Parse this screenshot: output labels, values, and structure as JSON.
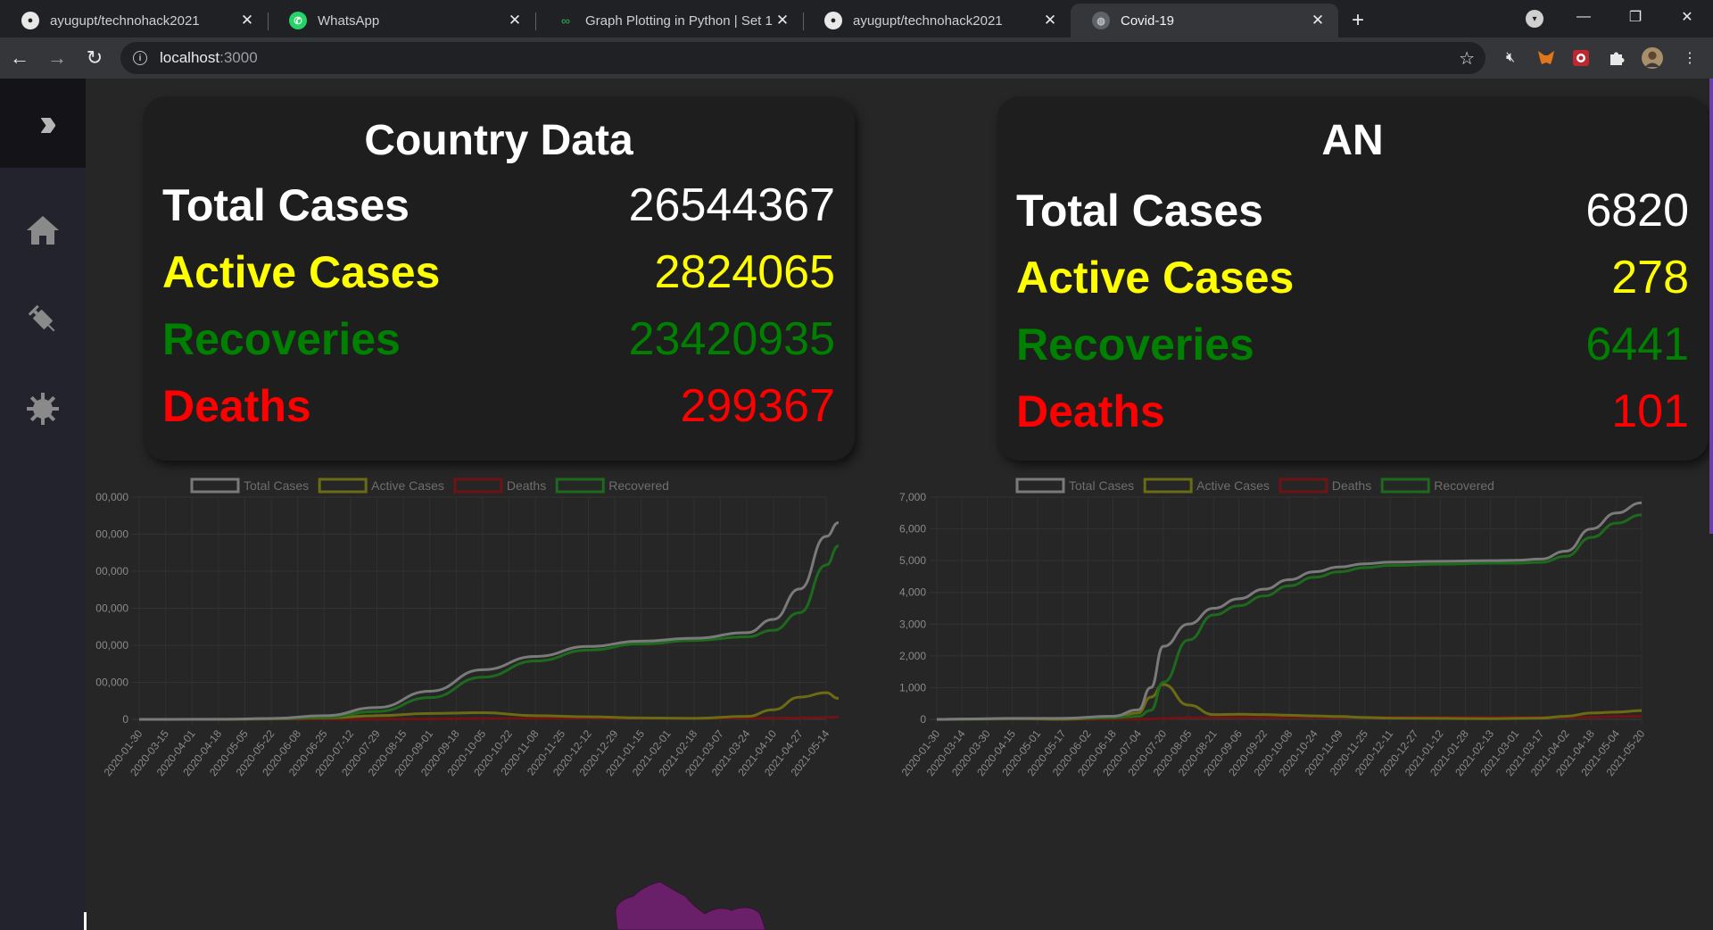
{
  "browser": {
    "tabs": [
      {
        "title": "ayugupt/technohack2021",
        "icon": "github-icon"
      },
      {
        "title": "WhatsApp",
        "icon": "whatsapp-icon"
      },
      {
        "title": "Graph Plotting in Python | Set 1 - ",
        "icon": "geeksforgeeks-icon"
      },
      {
        "title": "ayugupt/technohack2021",
        "icon": "github-icon"
      },
      {
        "title": "Covid-19",
        "icon": "globe-icon",
        "active": true
      }
    ],
    "url_host": "localhost",
    "url_port": ":3000"
  },
  "country": {
    "title": "Country Data",
    "total_label": "Total Cases",
    "total_value": "26544367",
    "active_label": "Active Cases",
    "active_value": "2824065",
    "recovered_label": "Recoveries",
    "recovered_value": "23420935",
    "deaths_label": "Deaths",
    "deaths_value": "299367"
  },
  "state": {
    "title": "AN",
    "total_label": "Total Cases",
    "total_value": "6820",
    "active_label": "Active Cases",
    "active_value": "278",
    "recovered_label": "Recoveries",
    "recovered_value": "6441",
    "deaths_label": "Deaths",
    "deaths_value": "101"
  },
  "colors": {
    "total": "#7a7a7a",
    "active": "#6b6b14",
    "deaths": "#6e1414",
    "recovered": "#1d6a1d"
  },
  "chart_data": [
    {
      "type": "line",
      "title": "",
      "legend": [
        "Total Cases",
        "Active Cases",
        "Deaths",
        "Recovered"
      ],
      "legend_position": "top",
      "y_tick_labels": [
        "0",
        "00,000",
        "00,000",
        "00,000",
        "00,000",
        "00,000",
        "00,000"
      ],
      "x_tick_labels": [
        "2020-01-30",
        "2020-03-15",
        "2020-04-01",
        "2020-04-18",
        "2020-05-05",
        "2020-05-22",
        "2020-06-08",
        "2020-06-25",
        "2020-07-12",
        "2020-07-29",
        "2020-08-15",
        "2020-09-01",
        "2020-09-18",
        "2020-10-05",
        "2020-10-22",
        "2020-11-08",
        "2020-11-25",
        "2020-12-12",
        "2020-12-29",
        "2021-01-15",
        "2021-02-01",
        "2021-02-18",
        "2021-03-07",
        "2021-03-24",
        "2021-04-10",
        "2021-04-27",
        "2021-05-14"
      ],
      "ylim": [
        0,
        30000000
      ],
      "grid": true,
      "x": [
        "2020-01-30",
        "2020-03-15",
        "2020-04-18",
        "2020-05-22",
        "2020-06-25",
        "2020-07-29",
        "2020-09-01",
        "2020-10-05",
        "2020-11-08",
        "2020-12-12",
        "2021-01-15",
        "2021-02-18",
        "2021-03-24",
        "2021-04-10",
        "2021-04-27",
        "2021-05-14",
        "2021-05-22"
      ],
      "series": [
        {
          "name": "Total Cases",
          "values": [
            1,
            100,
            15000,
            120000,
            490000,
            1600000,
            3800000,
            6700000,
            8500000,
            9850000,
            10550000,
            10950000,
            11700000,
            13500000,
            17600000,
            24700000,
            26544367
          ]
        },
        {
          "name": "Active Cases",
          "values": [
            1,
            80,
            11000,
            63000,
            190000,
            500000,
            800000,
            900000,
            500000,
            350000,
            200000,
            140000,
            400000,
            1300000,
            3000000,
            3600000,
            2824065
          ]
        },
        {
          "name": "Deaths",
          "values": [
            0,
            2,
            500,
            3600,
            15000,
            35000,
            65000,
            103000,
            123000,
            143000,
            152000,
            156000,
            160000,
            170000,
            195000,
            270000,
            299367
          ]
        },
        {
          "name": "Recovered",
          "values": [
            0,
            10,
            3500,
            53000,
            285000,
            1065000,
            2935000,
            5697000,
            7877000,
            9357000,
            10198000,
            10654000,
            11140000,
            12030000,
            14400000,
            20830000,
            23420935
          ]
        }
      ]
    },
    {
      "type": "line",
      "title": "",
      "legend": [
        "Total Cases",
        "Active Cases",
        "Deaths",
        "Recovered"
      ],
      "legend_position": "top",
      "y_tick_labels": [
        "0",
        "1,000",
        "2,000",
        "3,000",
        "4,000",
        "5,000",
        "6,000",
        "7,000"
      ],
      "x_tick_labels": [
        "2020-01-30",
        "2020-03-14",
        "2020-03-30",
        "2020-04-15",
        "2020-05-01",
        "2020-05-17",
        "2020-06-02",
        "2020-06-18",
        "2020-07-04",
        "2020-07-20",
        "2020-08-05",
        "2020-08-21",
        "2020-09-06",
        "2020-09-22",
        "2020-10-08",
        "2020-10-24",
        "2020-11-09",
        "2020-11-25",
        "2020-12-11",
        "2020-12-27",
        "2021-01-12",
        "2021-01-28",
        "2021-02-13",
        "2021-03-01",
        "2021-03-17",
        "2021-04-02",
        "2021-04-18",
        "2021-05-04",
        "2021-05-20"
      ],
      "ylim": [
        0,
        7000
      ],
      "grid": true,
      "x": [
        "2020-01-30",
        "2020-03-14",
        "2020-04-15",
        "2020-05-17",
        "2020-06-18",
        "2020-07-04",
        "2020-07-12",
        "2020-07-20",
        "2020-08-05",
        "2020-08-21",
        "2020-09-06",
        "2020-09-22",
        "2020-10-08",
        "2020-10-24",
        "2020-11-09",
        "2020-11-25",
        "2020-12-11",
        "2021-01-12",
        "2021-02-13",
        "2021-03-01",
        "2021-03-17",
        "2021-04-02",
        "2021-04-18",
        "2021-05-04",
        "2021-05-20"
      ],
      "series": [
        {
          "name": "Total Cases",
          "values": [
            0,
            10,
            33,
            33,
            100,
            300,
            1000,
            2300,
            3000,
            3500,
            3800,
            4100,
            4400,
            4650,
            4800,
            4900,
            4950,
            4980,
            5000,
            5010,
            5050,
            5300,
            6000,
            6500,
            6820
          ]
        },
        {
          "name": "Active Cases",
          "values": [
            0,
            8,
            20,
            3,
            50,
            200,
            700,
            1100,
            450,
            150,
            160,
            150,
            130,
            110,
            90,
            60,
            40,
            30,
            20,
            30,
            40,
            100,
            200,
            230,
            278
          ]
        },
        {
          "name": "Deaths",
          "values": [
            0,
            0,
            0,
            0,
            0,
            5,
            15,
            30,
            50,
            60,
            62,
            62,
            62,
            62,
            62,
            62,
            62,
            62,
            62,
            62,
            62,
            62,
            70,
            90,
            101
          ]
        },
        {
          "name": "Recovered",
          "values": [
            0,
            2,
            13,
            30,
            50,
            95,
            285,
            1170,
            2500,
            3290,
            3578,
            3888,
            4208,
            4478,
            4648,
            4778,
            4848,
            4888,
            4918,
            4918,
            4948,
            5138,
            5730,
            6180,
            6441
          ]
        }
      ]
    }
  ]
}
